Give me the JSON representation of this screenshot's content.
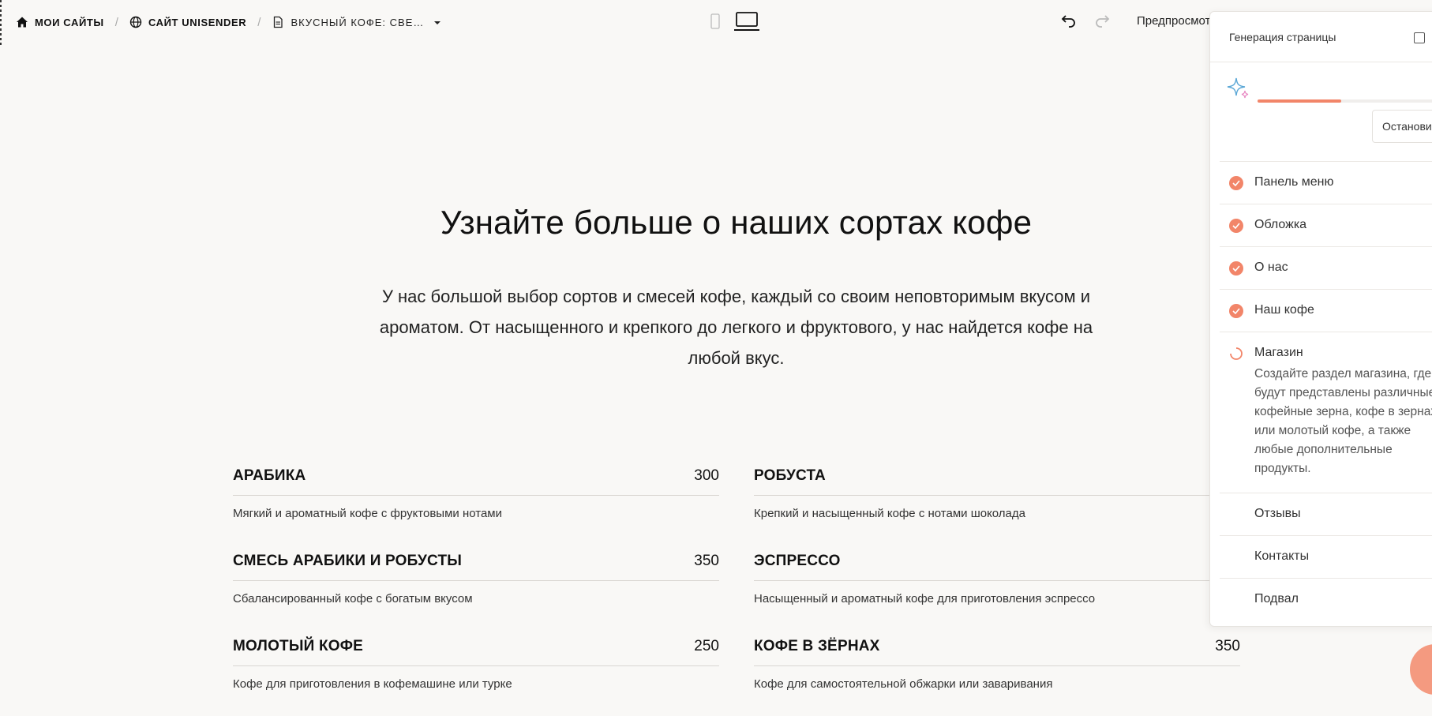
{
  "breadcrumbs": {
    "my_sites": "МОИ САЙТЫ",
    "site": "САЙТ UNISENDER",
    "page": "ВКУСНЫЙ КОФЕ: СВЕ…"
  },
  "icons": {
    "home": "home-icon",
    "globe": "globe-icon",
    "page": "document-icon",
    "caret": "caret-down-icon",
    "mobile": "mobile-icon",
    "desktop": "laptop-icon",
    "undo": "undo-icon",
    "redo": "redo-icon",
    "sparkle": "sparkle-icon"
  },
  "toolbar": {
    "preview_label": "Предпросмотр"
  },
  "main": {
    "heading": "Узнайте больше о наших сортах кофе",
    "intro": "У нас большой выбор сортов и смесей кофе, каждый со своим неповторимым вкусом и ароматом. От насыщенного и крепкого до легкого и фруктового, у нас найдется кофе на любой вкус.",
    "items": [
      {
        "name": "АРАБИКА",
        "price": "300",
        "desc": "Мягкий и ароматный кофе с фруктовыми нотами"
      },
      {
        "name": "РОБУСТА",
        "price": "",
        "desc": "Крепкий и насыщенный кофе с нотами шоколада"
      },
      {
        "name": "СМЕСЬ АРАБИКИ И РОБУСТЫ",
        "price": "350",
        "desc": "Сбалансированный кофе с богатым вкусом"
      },
      {
        "name": "ЭСПРЕССО",
        "price": "",
        "desc": "Насыщенный и ароматный кофе для приготовления эспрессо"
      },
      {
        "name": "МОЛОТЫЙ КОФЕ",
        "price": "250",
        "desc": "Кофе для приготовления в кофемашине или турке"
      },
      {
        "name": "КОФЕ В ЗЁРНАХ",
        "price": "350",
        "desc": "Кофе для самостоятельной обжарки или заваривания"
      }
    ]
  },
  "panel": {
    "title": "Генерация страницы",
    "progress": 0.44,
    "stop_label": "Остановить",
    "accent": "#f28569",
    "steps": [
      {
        "label": "Панель меню",
        "status": "done"
      },
      {
        "label": "Обложка",
        "status": "done"
      },
      {
        "label": "О нас",
        "status": "done"
      },
      {
        "label": "Наш кофе",
        "status": "done"
      },
      {
        "label": "Магазин",
        "status": "in-progress",
        "desc": "Создайте раздел магазина, где будут представлены различные кофейные зерна, кофе в зернах или молотый кофе, а также любые дополнительные продукты."
      },
      {
        "label": "Отзывы",
        "status": "pending"
      },
      {
        "label": "Контакты",
        "status": "pending"
      },
      {
        "label": "Подвал",
        "status": "pending"
      }
    ]
  }
}
